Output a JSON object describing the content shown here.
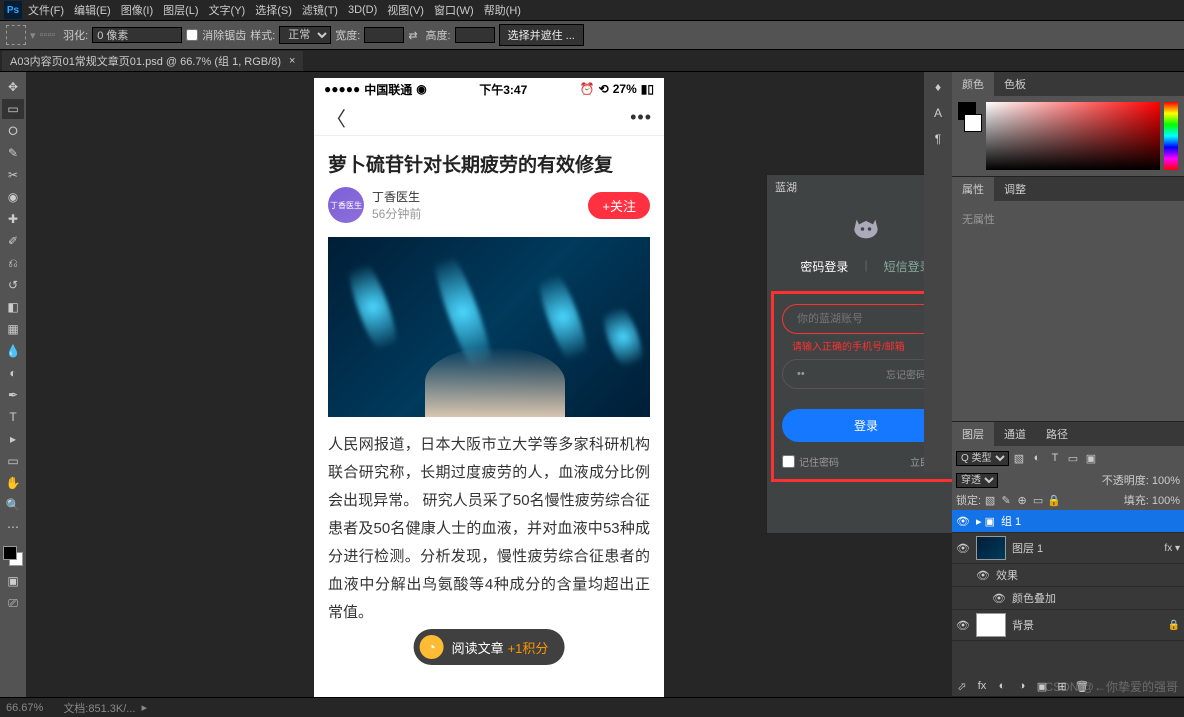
{
  "menu": {
    "items": [
      "文件(F)",
      "编辑(E)",
      "图像(I)",
      "图层(L)",
      "文字(Y)",
      "选择(S)",
      "滤镜(T)",
      "3D(D)",
      "视图(V)",
      "窗口(W)",
      "帮助(H)"
    ]
  },
  "options": {
    "feather_label": "羽化:",
    "feather_value": "0 像素",
    "antialias": "消除锯齿",
    "style_label": "样式:",
    "style_value": "正常",
    "width_label": "宽度:",
    "height_label": "高度:",
    "refine": "选择并遮住 ..."
  },
  "tab": {
    "name": "A03内容页01常规文章页01.psd @ 66.7% (组 1, RGB/8)"
  },
  "tools": [
    "↖",
    "▭",
    "◐",
    "✎",
    "▢",
    "✂",
    "◉",
    "⌖",
    "✚",
    "⎌",
    "◔",
    "◢",
    "⬚",
    "T",
    "▸",
    "✋",
    "⬛",
    "🔍",
    "⋯"
  ],
  "phone": {
    "carrier": "中国联通",
    "time": "下午3:47",
    "battery": "27%",
    "title": "萝卜硫苷针对长期疲劳的有效修复",
    "author": "丁香医生",
    "avatar_text": "丁香医生",
    "time_ago": "56分钟前",
    "follow": "+关注",
    "body": "人民网报道，日本大阪市立大学等多家科研机构联合研究称，长期过度疲劳的人，血液成分比例会出现异常。 研究人员采了50名慢性疲劳综合征患者及50名健康人士的血液，并对血液中53种成分进行检测。分析发现，慢性疲劳综合征患者的血液中分解出鸟氨酸等4种成分的含量均超出正常值。",
    "read_label": "阅读文章",
    "read_points": "+1积分"
  },
  "login": {
    "panel_title": "蓝湖",
    "tab_pw": "密码登录",
    "tab_sms": "短信登录",
    "account_placeholder": "你的蓝湖账号",
    "error": "请输入正确的手机号/邮箱",
    "password_value": "••",
    "forgot": "忘记密码？",
    "login_btn": "登录",
    "remember": "记住密码",
    "register": "立即注册"
  },
  "panels": {
    "tab_color": "颜色",
    "tab_swatch": "色板",
    "tab_props": "属性",
    "tab_adjust": "调整",
    "no_attr": "无属性",
    "tab_layers": "图层",
    "tab_channels": "通道",
    "tab_paths": "路径",
    "kind": "Q 类型",
    "blend": "穿透",
    "opacity_label": "不透明度:",
    "opacity_val": "100%",
    "lock_label": "锁定:",
    "fill_label": "填充:",
    "fill_val": "100%",
    "layers": [
      {
        "name": "组 1",
        "selected": true,
        "folder": true
      },
      {
        "name": "图层 1",
        "fx": true
      },
      {
        "name": "效果",
        "sub": true
      },
      {
        "name": "颜色叠加",
        "sub": true
      },
      {
        "name": "背景",
        "locked": true
      }
    ]
  },
  "status": {
    "zoom": "66.67%",
    "doc": "文档:851.3K/..."
  },
  "watermark": "CSDN @←你挚爱的强哥"
}
